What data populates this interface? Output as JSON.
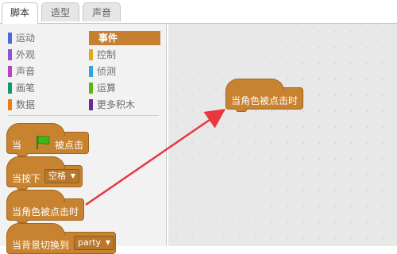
{
  "tabs": [
    {
      "label": "脚本"
    },
    {
      "label": "造型"
    },
    {
      "label": "声音"
    }
  ],
  "categories": [
    {
      "label": "运动",
      "color": "#4a6cd4"
    },
    {
      "label": "外观",
      "color": "#8a55d7"
    },
    {
      "label": "声音",
      "color": "#bb42c3"
    },
    {
      "label": "画笔",
      "color": "#0e9a6c"
    },
    {
      "label": "数据",
      "color": "#ee7d16"
    },
    {
      "label": "事件",
      "color": "#c88330",
      "selected": true
    },
    {
      "label": "控制",
      "color": "#e1a91a"
    },
    {
      "label": "侦测",
      "color": "#2ca5e2"
    },
    {
      "label": "运算",
      "color": "#5cb712"
    },
    {
      "label": "更多积木",
      "color": "#632d99"
    }
  ],
  "blocks": {
    "flag_clicked": {
      "prefix": "当",
      "suffix": "被点击"
    },
    "key_pressed": {
      "prefix": "当按下",
      "key": "空格"
    },
    "sprite_clicked": {
      "label": "当角色被点击时"
    },
    "backdrop_switch": {
      "prefix": "当背景切换到",
      "backdrop": "party"
    }
  },
  "script": {
    "sprite_clicked": {
      "label": "当角色被点击时"
    }
  },
  "colors": {
    "event_block": "#c88330",
    "arrow": "#e8373d"
  }
}
